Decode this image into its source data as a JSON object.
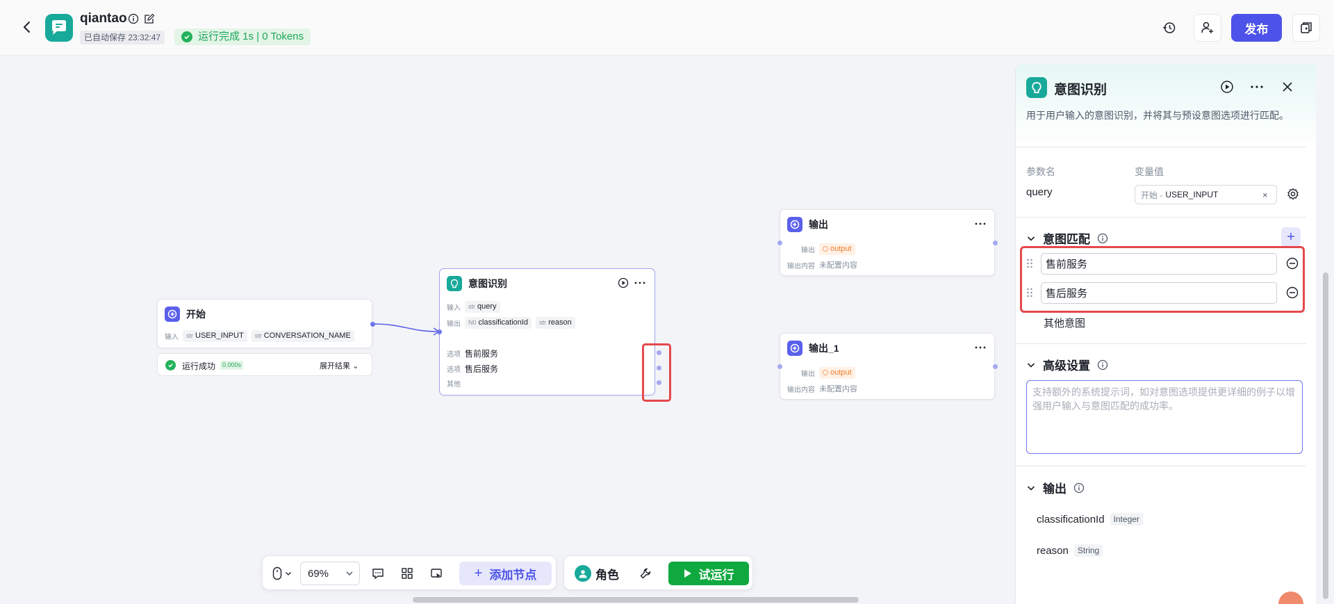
{
  "header": {
    "app_name": "qiantao",
    "autosave": "已自动保存 23:32:47",
    "run_status": "运行完成 1s | 0 Tokens",
    "publish_label": "发布"
  },
  "canvas": {
    "start_node": {
      "title": "开始",
      "input_label": "输入",
      "inputs": [
        {
          "type": "str",
          "name": "USER_INPUT"
        },
        {
          "type": "str",
          "name": "CONVERSATION_NAME"
        }
      ],
      "run_result": "运行成功",
      "run_time": "0.000s",
      "expand_label": "展开结果"
    },
    "intent_node": {
      "title": "意图识别",
      "input_label": "输入",
      "input": {
        "type": "str",
        "name": "query"
      },
      "output_label": "输出",
      "outputs": [
        {
          "type": "N0",
          "name": "classificationId"
        },
        {
          "type": "str",
          "name": "reason"
        }
      ],
      "option_label": "选项",
      "options": [
        "售前服务",
        "售后服务"
      ],
      "other_label": "其他"
    },
    "output_node": {
      "title": "输出",
      "output_label": "输出",
      "output_tag": "output",
      "content_label": "输出内容",
      "content_value": "未配置内容"
    },
    "output1_node": {
      "title": "输出_1",
      "output_label": "输出",
      "output_tag": "output",
      "content_label": "输出内容",
      "content_value": "未配置内容"
    }
  },
  "toolbar": {
    "zoom": "69%",
    "add_node_label": "添加节点",
    "role_label": "角色",
    "try_run_label": "试运行"
  },
  "panel": {
    "title": "意图识别",
    "description": "用于用户输入的意图识别，并将其与预设意图选项进行匹配。",
    "param_name_label": "参数名",
    "var_value_label": "变量值",
    "param_name": "query",
    "var_source": "开始 -",
    "var_name": "USER_INPUT",
    "var_clear": "×",
    "intent_section": "意图匹配",
    "intents": [
      "售前服务",
      "售后服务"
    ],
    "other_intent": "其他意图",
    "advanced_section": "高级设置",
    "advanced_placeholder": "支持额外的系统提示词，如对意图选项提供更详细的例子以增强用户输入与意图匹配的成功率。",
    "output_section": "输出",
    "outputs": [
      {
        "name": "classificationId",
        "type": "Integer"
      },
      {
        "name": "reason",
        "type": "String"
      }
    ]
  },
  "colors": {
    "brand": "#4d53e8",
    "teal": "#17a99a",
    "success": "#23b15c",
    "highlight": "#e5484d",
    "output_tag": "#f07c2a"
  }
}
